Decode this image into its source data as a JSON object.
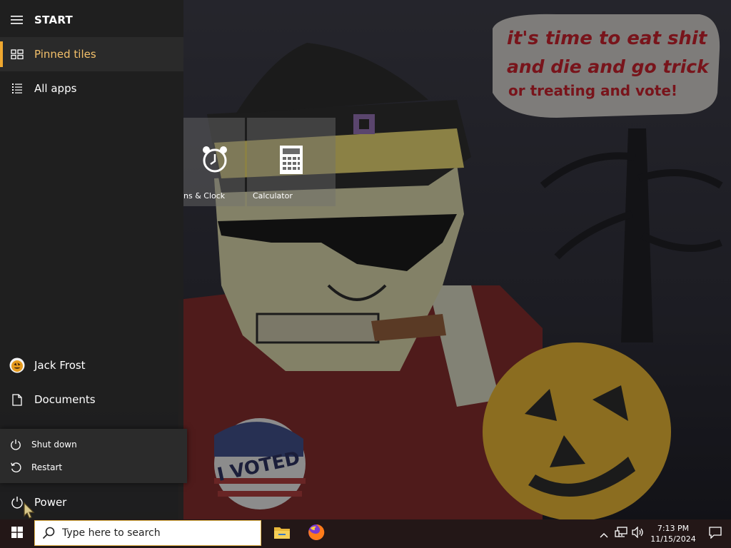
{
  "wallpaper": {
    "speech_bubble_lines": [
      "it's time to eat shit",
      "and die and go trick",
      "or treating and vote!"
    ],
    "sticker_text": "I VOTED"
  },
  "start_menu": {
    "header": {
      "label": "START",
      "icon": "hamburger-icon"
    },
    "nav": [
      {
        "label": "Pinned tiles",
        "icon": "tiles-icon",
        "active": true
      },
      {
        "label": "All apps",
        "icon": "list-icon",
        "active": false
      }
    ],
    "user": {
      "name": "Jack Frost",
      "icon": "user-avatar-icon"
    },
    "documents": {
      "label": "Documents",
      "icon": "document-icon"
    },
    "power": {
      "label": "Power",
      "icon": "power-icon"
    },
    "power_flyout": [
      {
        "label": "Shut down",
        "icon": "power-icon"
      },
      {
        "label": "Restart",
        "icon": "restart-icon"
      }
    ],
    "accent_color": "#f0a830"
  },
  "tiles": [
    {
      "label": "ns & Clock",
      "icon": "alarm-clock-icon"
    },
    {
      "label": "Calculator",
      "icon": "calculator-icon"
    }
  ],
  "taskbar": {
    "search_placeholder": "Type here to search",
    "apps": [
      {
        "name": "File Explorer",
        "icon": "folder-icon"
      },
      {
        "name": "Firefox",
        "icon": "firefox-icon"
      }
    ],
    "tray": {
      "time": "7:13 PM",
      "date": "11/15/2024"
    }
  }
}
